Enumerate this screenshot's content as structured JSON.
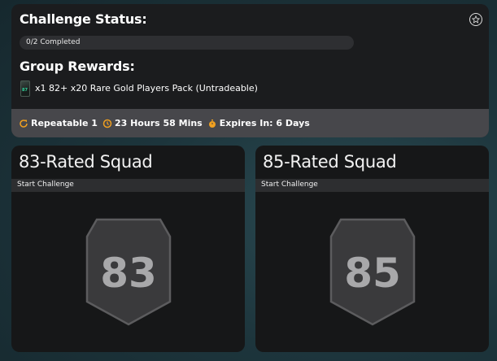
{
  "status": {
    "title": "Challenge Status:",
    "progress_text": "0/2 Completed",
    "progress_fraction": 0
  },
  "rewards": {
    "title": "Group Rewards:",
    "pack_tag": "87",
    "item": "x1 82+ x20 Rare Gold Players Pack (Untradeable)"
  },
  "status_bar": {
    "repeatable": "Repeatable 1",
    "time": "23 Hours 58 Mins",
    "expires": "Expires In: 6 Days"
  },
  "squads": [
    {
      "title": "83-Rated Squad",
      "start_label": "Start Challenge",
      "rating": "83"
    },
    {
      "title": "85-Rated Squad",
      "start_label": "Start Challenge",
      "rating": "85"
    }
  ],
  "colors": {
    "panel": "#1b1c1e",
    "status_bar": "#47474b",
    "icon_orange": "#f0a020",
    "badge_fill": "#3a3a3c",
    "badge_text": "#a8a8aa"
  }
}
